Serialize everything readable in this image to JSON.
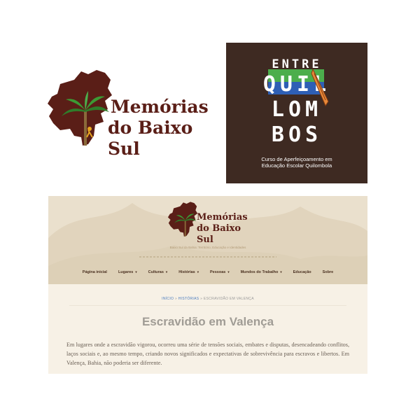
{
  "logo_top": {
    "line1": "Memórias",
    "line2": "do Baixo Sul"
  },
  "entre_box": {
    "entre": "ENTRE",
    "row1": "QUIL",
    "row2": "LOM",
    "row3": "BOS",
    "subtitle1": "Curso de Aperfeiçoamento em",
    "subtitle2": "Educação Escolar Quilombola"
  },
  "site": {
    "logo_line1": "Memórias",
    "logo_line2": "do Baixo Sul",
    "tagline": "Baixo Sul da Bahia: Território, Educação e Identidades",
    "nav": [
      {
        "label": "Página inicial",
        "has_dropdown": false
      },
      {
        "label": "Lugares",
        "has_dropdown": true
      },
      {
        "label": "Culturas",
        "has_dropdown": true
      },
      {
        "label": "Histórias",
        "has_dropdown": true
      },
      {
        "label": "Pessoas",
        "has_dropdown": true
      },
      {
        "label": "Mundos do Trabalho",
        "has_dropdown": true
      },
      {
        "label": "Educação",
        "has_dropdown": false
      },
      {
        "label": "Sobre",
        "has_dropdown": false
      }
    ],
    "breadcrumb": {
      "home": "INÍCIO",
      "section": "HISTÓRIAS",
      "current": "ESCRAVIDÃO EM VALENÇA",
      "separator": "»"
    },
    "title": "Escravidão em Valença",
    "body": "Em lugares onde a escravidão vigorou, ocorreu uma série de tensões sociais, embates e disputas, desencadeando conflitos, laços sociais e, ao mesmo tempo, criando novos significados e expectativas de sobrevivência para escravos e libertos. Em Valença, Bahia, não poderia ser diferente."
  },
  "colors": {
    "brand_brown": "#5a1e17",
    "box_bg": "#3e2a22",
    "palm_green": "#3c8a2e",
    "link_blue": "#4a7bbf"
  }
}
